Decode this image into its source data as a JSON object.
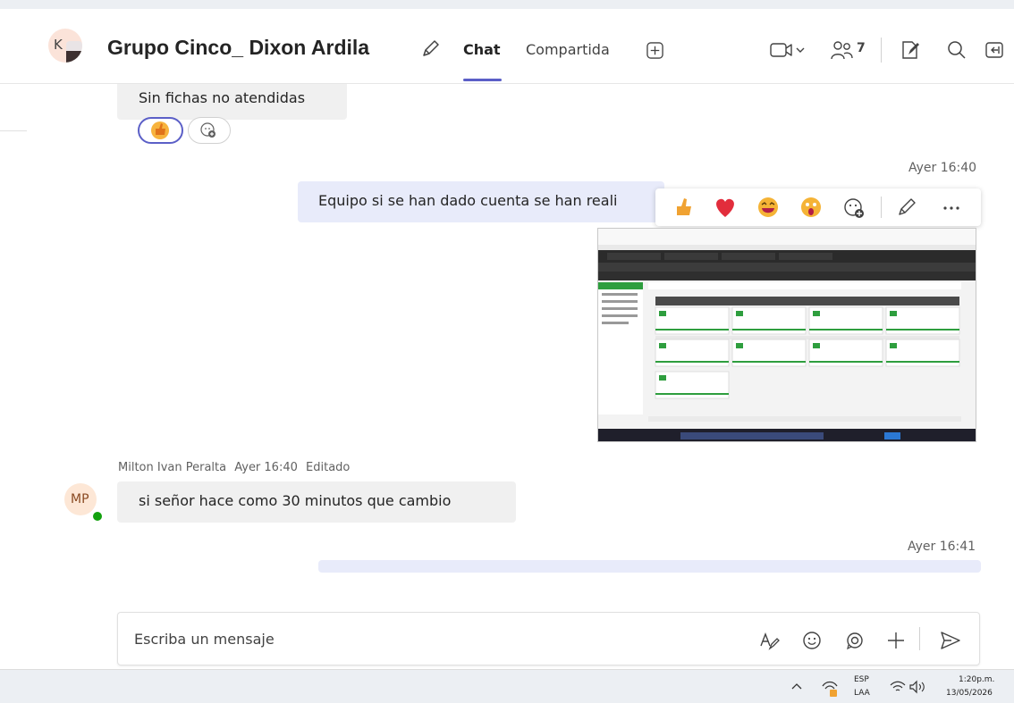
{
  "header": {
    "avatar_initial": "K",
    "title": "Grupo Cinco_ Dixon Ardila",
    "tabs": [
      {
        "label": "Chat",
        "active": true
      },
      {
        "label": "Compartida",
        "active": false
      }
    ],
    "people_count": "7",
    "icons": [
      "edit-name-icon",
      "add-tab-icon",
      "video-call-icon",
      "people-icon",
      "new-chat-icon",
      "compose-icon",
      "search-icon",
      "popout-icon"
    ]
  },
  "messages": [
    {
      "text": "Sin fichas no atendidas",
      "reaction": "thumbs-up",
      "reaction_active": true
    },
    {
      "timestamp": "Ayer 16:40",
      "text": "Equipo si se han dado cuenta se han reali",
      "has_image": true
    },
    {
      "author": "Milton Ivan Peralta",
      "time": "Ayer 16:40",
      "status": "Editado",
      "avatar_initials": "MP",
      "text": "si señor hace como 30 minutos que cambio"
    },
    {
      "timestamp": "Ayer 16:41",
      "text": "..."
    }
  ],
  "reaction_bar": [
    "thumbs-up",
    "heart",
    "laugh",
    "surprised",
    "add-reaction",
    "edit",
    "more"
  ],
  "compose": {
    "placeholder": "Escriba un mensaje",
    "icons": [
      "format-icon",
      "emoji-icon",
      "loop-icon",
      "attach-plus-icon",
      "send-icon"
    ]
  },
  "taskbar": {
    "language": "ESP",
    "layout": "LAA",
    "time": "1:20p.m.",
    "date": "13/05/2026"
  },
  "colors": {
    "accent": "#5b5fc7",
    "bubble_out": "#e8ebfa",
    "bubble_in": "#f0f0f0",
    "presence": "#13a10e"
  }
}
